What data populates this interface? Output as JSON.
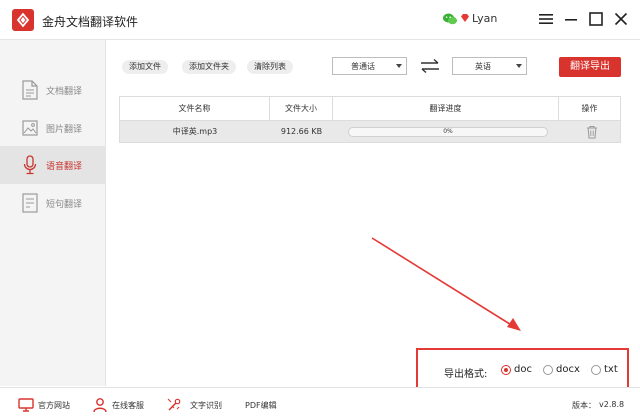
{
  "app": {
    "title": "金舟文档翻译软件"
  },
  "user": {
    "name": "Lyan"
  },
  "colors": {
    "accent": "#d9332e",
    "annotation": "#e53935"
  },
  "sidebar": {
    "items": [
      {
        "label": "文档翻译",
        "icon": "document-icon",
        "active": false
      },
      {
        "label": "图片翻译",
        "icon": "image-icon",
        "active": false
      },
      {
        "label": "语音翻译",
        "icon": "microphone-icon",
        "active": true
      },
      {
        "label": "短句翻译",
        "icon": "note-icon",
        "active": false
      }
    ]
  },
  "toolbar": {
    "add_file": "添加文件",
    "add_folder": "添加文件夹",
    "clear_list": "清除列表",
    "source_language": "普通话",
    "target_language": "英语",
    "export_button": "翻译导出"
  },
  "table": {
    "headers": [
      "文件名称",
      "文件大小",
      "翻译进度",
      "操作"
    ],
    "rows": [
      {
        "name": "中译英.mp3",
        "size": "912.66 KB",
        "progress_text": "0%",
        "progress": 0
      }
    ]
  },
  "export_format": {
    "label": "导出格式:",
    "options": [
      "doc",
      "docx",
      "txt"
    ],
    "selected": "doc"
  },
  "footer": {
    "website": "官方网站",
    "support": "在线客服",
    "ocr": "文字识别",
    "pdf": "PDF编辑",
    "version_label": "版本：",
    "version": "v2.8.8"
  }
}
